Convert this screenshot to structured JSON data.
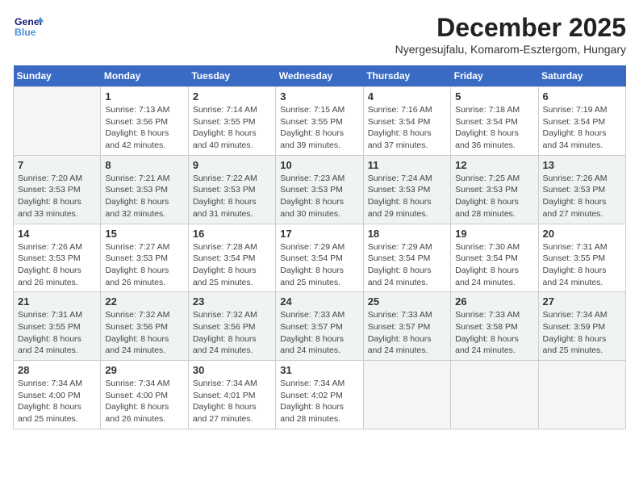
{
  "header": {
    "logo_line1": "General",
    "logo_line2": "Blue",
    "month_title": "December 2025",
    "subtitle": "Nyergesujfalu, Komarom-Esztergom, Hungary"
  },
  "days_of_week": [
    "Sunday",
    "Monday",
    "Tuesday",
    "Wednesday",
    "Thursday",
    "Friday",
    "Saturday"
  ],
  "weeks": [
    [
      {
        "day": "",
        "info": ""
      },
      {
        "day": "1",
        "info": "Sunrise: 7:13 AM\nSunset: 3:56 PM\nDaylight: 8 hours\nand 42 minutes."
      },
      {
        "day": "2",
        "info": "Sunrise: 7:14 AM\nSunset: 3:55 PM\nDaylight: 8 hours\nand 40 minutes."
      },
      {
        "day": "3",
        "info": "Sunrise: 7:15 AM\nSunset: 3:55 PM\nDaylight: 8 hours\nand 39 minutes."
      },
      {
        "day": "4",
        "info": "Sunrise: 7:16 AM\nSunset: 3:54 PM\nDaylight: 8 hours\nand 37 minutes."
      },
      {
        "day": "5",
        "info": "Sunrise: 7:18 AM\nSunset: 3:54 PM\nDaylight: 8 hours\nand 36 minutes."
      },
      {
        "day": "6",
        "info": "Sunrise: 7:19 AM\nSunset: 3:54 PM\nDaylight: 8 hours\nand 34 minutes."
      }
    ],
    [
      {
        "day": "7",
        "info": "Sunrise: 7:20 AM\nSunset: 3:53 PM\nDaylight: 8 hours\nand 33 minutes."
      },
      {
        "day": "8",
        "info": "Sunrise: 7:21 AM\nSunset: 3:53 PM\nDaylight: 8 hours\nand 32 minutes."
      },
      {
        "day": "9",
        "info": "Sunrise: 7:22 AM\nSunset: 3:53 PM\nDaylight: 8 hours\nand 31 minutes."
      },
      {
        "day": "10",
        "info": "Sunrise: 7:23 AM\nSunset: 3:53 PM\nDaylight: 8 hours\nand 30 minutes."
      },
      {
        "day": "11",
        "info": "Sunrise: 7:24 AM\nSunset: 3:53 PM\nDaylight: 8 hours\nand 29 minutes."
      },
      {
        "day": "12",
        "info": "Sunrise: 7:25 AM\nSunset: 3:53 PM\nDaylight: 8 hours\nand 28 minutes."
      },
      {
        "day": "13",
        "info": "Sunrise: 7:26 AM\nSunset: 3:53 PM\nDaylight: 8 hours\nand 27 minutes."
      }
    ],
    [
      {
        "day": "14",
        "info": "Sunrise: 7:26 AM\nSunset: 3:53 PM\nDaylight: 8 hours\nand 26 minutes."
      },
      {
        "day": "15",
        "info": "Sunrise: 7:27 AM\nSunset: 3:53 PM\nDaylight: 8 hours\nand 26 minutes."
      },
      {
        "day": "16",
        "info": "Sunrise: 7:28 AM\nSunset: 3:54 PM\nDaylight: 8 hours\nand 25 minutes."
      },
      {
        "day": "17",
        "info": "Sunrise: 7:29 AM\nSunset: 3:54 PM\nDaylight: 8 hours\nand 25 minutes."
      },
      {
        "day": "18",
        "info": "Sunrise: 7:29 AM\nSunset: 3:54 PM\nDaylight: 8 hours\nand 24 minutes."
      },
      {
        "day": "19",
        "info": "Sunrise: 7:30 AM\nSunset: 3:54 PM\nDaylight: 8 hours\nand 24 minutes."
      },
      {
        "day": "20",
        "info": "Sunrise: 7:31 AM\nSunset: 3:55 PM\nDaylight: 8 hours\nand 24 minutes."
      }
    ],
    [
      {
        "day": "21",
        "info": "Sunrise: 7:31 AM\nSunset: 3:55 PM\nDaylight: 8 hours\nand 24 minutes."
      },
      {
        "day": "22",
        "info": "Sunrise: 7:32 AM\nSunset: 3:56 PM\nDaylight: 8 hours\nand 24 minutes."
      },
      {
        "day": "23",
        "info": "Sunrise: 7:32 AM\nSunset: 3:56 PM\nDaylight: 8 hours\nand 24 minutes."
      },
      {
        "day": "24",
        "info": "Sunrise: 7:33 AM\nSunset: 3:57 PM\nDaylight: 8 hours\nand 24 minutes."
      },
      {
        "day": "25",
        "info": "Sunrise: 7:33 AM\nSunset: 3:57 PM\nDaylight: 8 hours\nand 24 minutes."
      },
      {
        "day": "26",
        "info": "Sunrise: 7:33 AM\nSunset: 3:58 PM\nDaylight: 8 hours\nand 24 minutes."
      },
      {
        "day": "27",
        "info": "Sunrise: 7:34 AM\nSunset: 3:59 PM\nDaylight: 8 hours\nand 25 minutes."
      }
    ],
    [
      {
        "day": "28",
        "info": "Sunrise: 7:34 AM\nSunset: 4:00 PM\nDaylight: 8 hours\nand 25 minutes."
      },
      {
        "day": "29",
        "info": "Sunrise: 7:34 AM\nSunset: 4:00 PM\nDaylight: 8 hours\nand 26 minutes."
      },
      {
        "day": "30",
        "info": "Sunrise: 7:34 AM\nSunset: 4:01 PM\nDaylight: 8 hours\nand 27 minutes."
      },
      {
        "day": "31",
        "info": "Sunrise: 7:34 AM\nSunset: 4:02 PM\nDaylight: 8 hours\nand 28 minutes."
      },
      {
        "day": "",
        "info": ""
      },
      {
        "day": "",
        "info": ""
      },
      {
        "day": "",
        "info": ""
      }
    ]
  ]
}
